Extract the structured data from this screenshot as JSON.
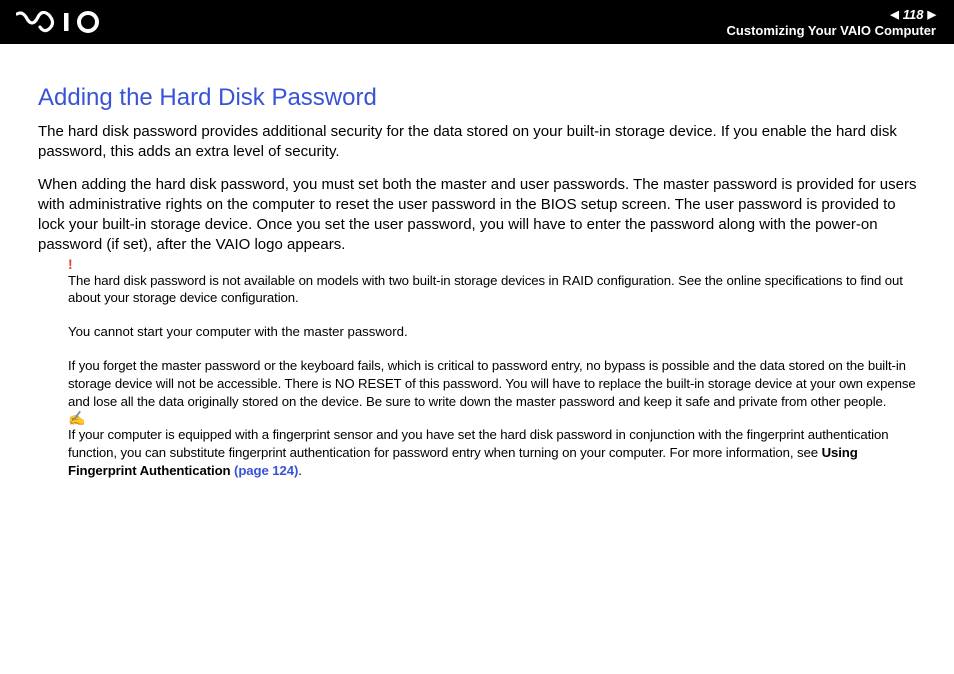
{
  "header": {
    "page_number": "118",
    "section": "Customizing Your VAIO Computer"
  },
  "content": {
    "title": "Adding the Hard Disk Password",
    "p1": "The hard disk password provides additional security for the data stored on your built-in storage device. If you enable the hard disk password, this adds an extra level of security.",
    "p2": "When adding the hard disk password, you must set both the master and user passwords. The master password is provided for users with administrative rights on the computer to reset the user password in the BIOS setup screen. The user password is provided to lock your built-in storage device. Once you set the user password, you will have to enter the password along with the power-on password (if set), after the VAIO logo appears.",
    "warn_icon": "!",
    "n1": "The hard disk password is not available on models with two built-in storage devices in RAID configuration. See the online specifications to find out about your storage device configuration.",
    "n2": "You cannot start your computer with the master password.",
    "n3": "If you forget the master password or the keyboard fails, which is critical to password entry, no bypass is possible and the data stored on the built-in storage device will not be accessible. There is NO RESET of this password. You will have to replace the built-in storage device at your own expense and lose all the data originally stored on the device. Be sure to write down the master password and keep it safe and private from other people.",
    "tip_icon": "✍",
    "n4a": "If your computer is equipped with a fingerprint sensor and you have set the hard disk password in conjunction with the fingerprint authentication function, you can substitute fingerprint authentication for password entry when turning on your computer. For more information, see ",
    "n4b": "Using Fingerprint Authentication ",
    "n4c": "(page 124)",
    "n4d": "."
  }
}
